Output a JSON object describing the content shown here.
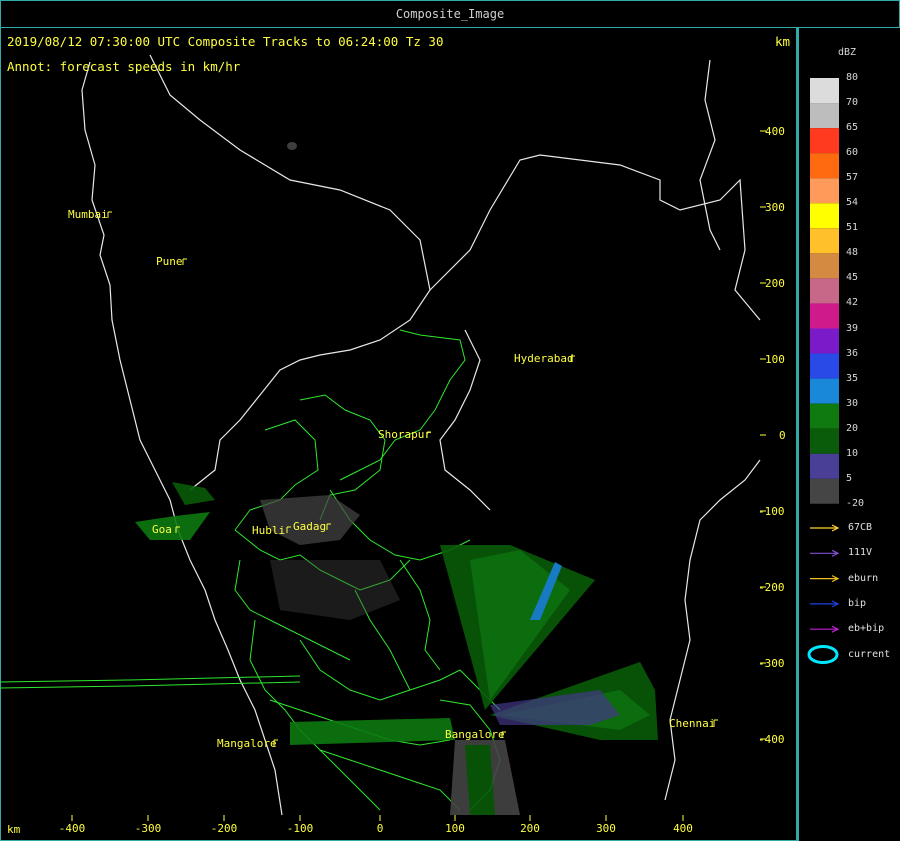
{
  "window": {
    "title": "Composite_Image"
  },
  "header": {
    "line1": "2019/08/12 07:30:00 UTC Composite Tracks to 06:24:00 Tz 30",
    "line2": "Annot: forecast speeds in km/hr",
    "unit_right": "km",
    "unit_bottom": "km"
  },
  "cities": [
    {
      "name": "Mumbai"
    },
    {
      "name": "Pune"
    },
    {
      "name": "Hyderabad"
    },
    {
      "name": "Shorapur"
    },
    {
      "name": "Goa"
    },
    {
      "name": "Hubli"
    },
    {
      "name": "Gadag"
    },
    {
      "name": "Mangalore"
    },
    {
      "name": "Bangalore"
    },
    {
      "name": "Chennai"
    }
  ],
  "axes": {
    "y_ticks": [
      "400",
      "300",
      "200",
      "100",
      "0",
      "-100",
      "-200",
      "-300",
      "-400"
    ],
    "x_ticks": [
      "-400",
      "-300",
      "-200",
      "-100",
      "0",
      "100",
      "200",
      "300",
      "400"
    ]
  },
  "scale": {
    "unit": "dBZ",
    "levels": [
      {
        "label": "80",
        "color": "#dcdcdc"
      },
      {
        "label": "70",
        "color": "#bdbdbd"
      },
      {
        "label": "65",
        "color": "#ff3a1f"
      },
      {
        "label": "60",
        "color": "#ff6a10"
      },
      {
        "label": "57",
        "color": "#ff9a5a"
      },
      {
        "label": "54",
        "color": "#ffff00"
      },
      {
        "label": "51",
        "color": "#ffc02a"
      },
      {
        "label": "48",
        "color": "#d48a40"
      },
      {
        "label": "45",
        "color": "#c86888"
      },
      {
        "label": "42",
        "color": "#cf1a8c"
      },
      {
        "label": "39",
        "color": "#7a1ac8"
      },
      {
        "label": "36",
        "color": "#2a4ae8"
      },
      {
        "label": "35",
        "color": "#1a88d8"
      },
      {
        "label": "30",
        "color": "#0e7a10"
      },
      {
        "label": "20",
        "color": "#0a5c0a"
      },
      {
        "label": "10",
        "color": "#4a3f96"
      },
      {
        "label": "5",
        "color": "#454545"
      },
      {
        "label": "-20",
        "color": "#000000"
      }
    ]
  },
  "legend": [
    {
      "label": "67CB",
      "color": "#ffd030"
    },
    {
      "label": "111V",
      "color": "#8050d0"
    },
    {
      "label": "eburn",
      "color": "#f0c020"
    },
    {
      "label": "bip",
      "color": "#2040e0"
    },
    {
      "label": "eb+bip",
      "color": "#c020d0"
    },
    {
      "label": "current",
      "color": "#00e8ff"
    }
  ]
}
